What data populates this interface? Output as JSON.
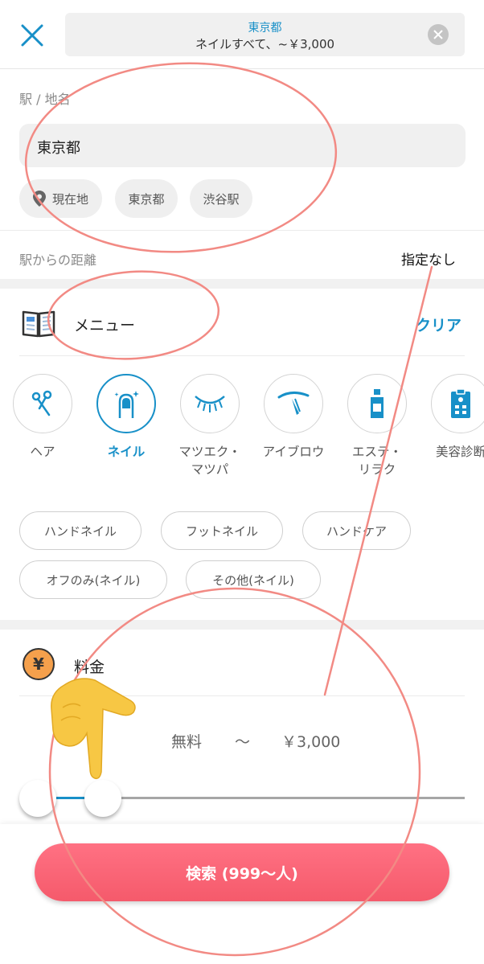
{
  "header": {
    "area": "東京都",
    "condition": "ネイルすべて、~￥3,000"
  },
  "location": {
    "label": "駅 / 地名",
    "input_value": "東京都",
    "chips": [
      "現在地",
      "東京都",
      "渋谷駅"
    ]
  },
  "distance": {
    "label": "駅からの距離",
    "value": "指定なし"
  },
  "menu": {
    "title": "メニュー",
    "clear_label": "クリア",
    "categories": [
      "ヘア",
      "ネイル",
      "マツエク・\nマツパ",
      "アイブロウ",
      "エステ・\nリラク",
      "美容診断"
    ],
    "selected_category": "ネイル",
    "subchips": [
      "ハンドネイル",
      "フットネイル",
      "ハンドケア",
      "オフのみ(ネイル)",
      "その他(ネイル)"
    ]
  },
  "price": {
    "title": "料金",
    "icon_symbol": "¥",
    "min": "無料",
    "separator": "〜",
    "max": "￥3,000"
  },
  "search_button": "検索 (999〜人)",
  "colors": {
    "accent": "#1890c8",
    "search_button": "#ff6677",
    "annotation": "#f28a84"
  }
}
